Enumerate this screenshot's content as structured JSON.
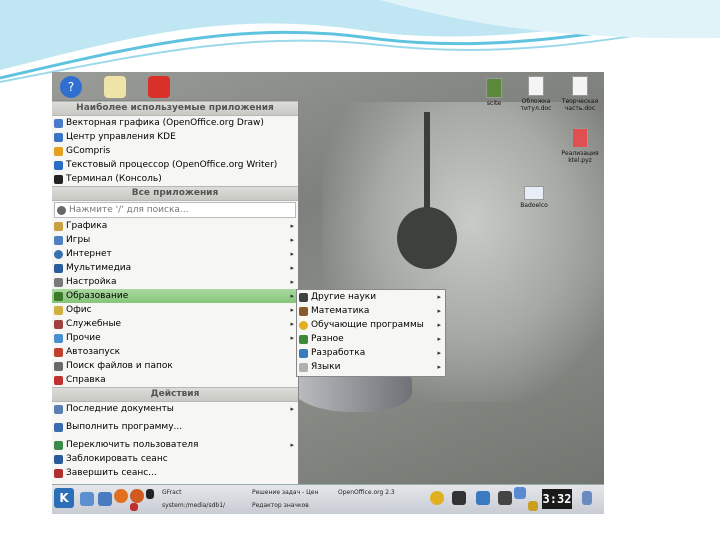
{
  "topbar_icons": [
    "help-icon",
    "notes-icon",
    "pdf-icon"
  ],
  "desktop_icons": [
    {
      "label": "scite"
    },
    {
      "label": "Обложка титул.doc"
    },
    {
      "label": "Творческая часть.doc"
    },
    {
      "label": "Реализация ktel.pyz"
    },
    {
      "label": "Badoelco"
    }
  ],
  "menu": {
    "header_frequent": "Наиболее используемые приложения",
    "frequent": [
      "Векторная графика (OpenOffice.org Draw)",
      "Центр управления KDE",
      "GCompris",
      "Текстовый процессор (OpenOffice.org Writer)",
      "Терминал (Консоль)"
    ],
    "header_all": "Все приложения",
    "search_placeholder": "Нажмите '/' для поиска...",
    "categories": [
      "Графика",
      "Игры",
      "Интернет",
      "Мультимедиа",
      "Настройка",
      "Образование",
      "Офис",
      "Служебные",
      "Прочие"
    ],
    "extra": [
      "Автозапуск",
      "Поиск файлов и папок",
      "Справка"
    ],
    "header_actions": "Действия",
    "actions": [
      "Последние документы",
      "Выполнить программу...",
      "Переключить пользователя",
      "Заблокировать сеанс",
      "Завершить сеанс..."
    ]
  },
  "submenu": {
    "items": [
      "Другие науки",
      "Математика",
      "Обучающие программы",
      "Разное",
      "Разработка",
      "Языки"
    ]
  },
  "taskbar": {
    "start_label": "K",
    "tasks": [
      "GFract",
      "Решение задач - Цен",
      "OpenOffice.org 2.3",
      "system:/media/sdb1/",
      "Редактор значков"
    ],
    "clock": "3:32"
  }
}
